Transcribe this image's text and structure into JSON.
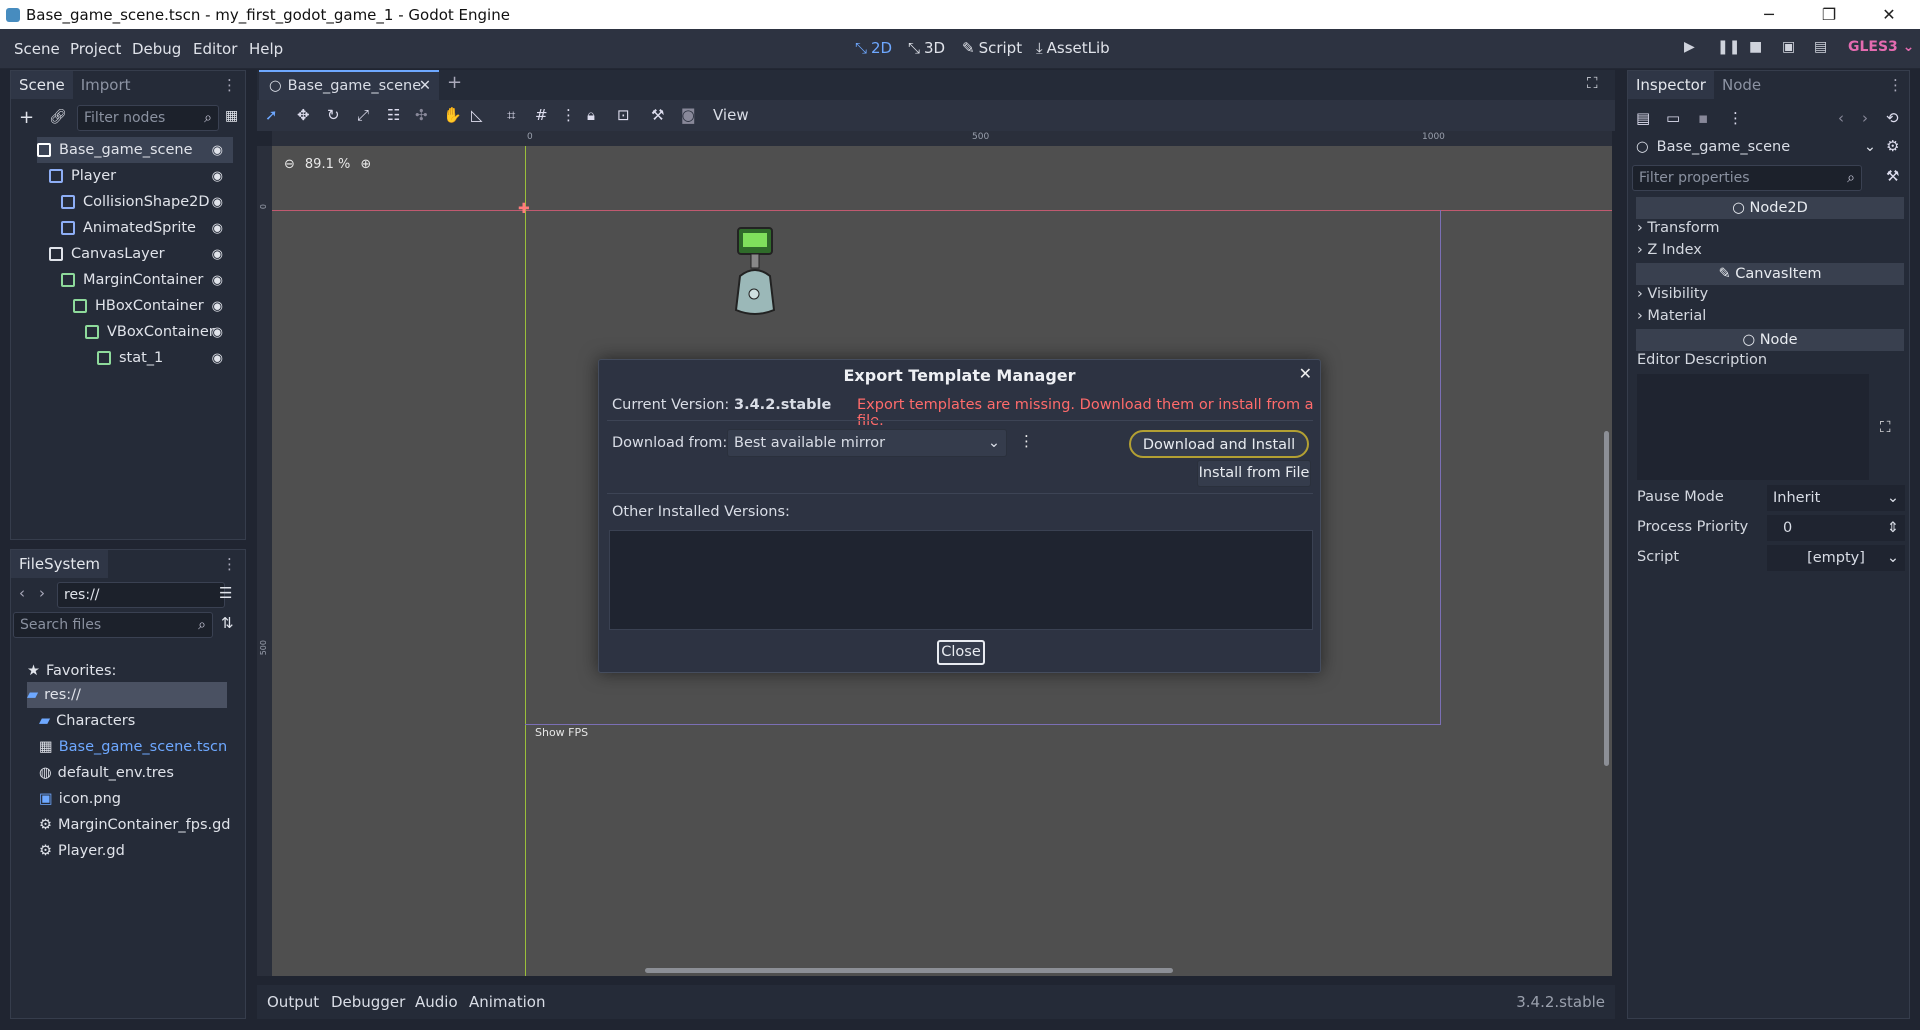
{
  "window": {
    "title": "Base_game_scene.tscn - my_first_godot_game_1 - Godot Engine",
    "min": "─",
    "max": "❐",
    "close": "✕"
  },
  "menu": {
    "items": [
      "Scene",
      "Project",
      "Debug",
      "Editor",
      "Help"
    ]
  },
  "workspaces": {
    "w2d": "2D",
    "w3d": "3D",
    "script": "Script",
    "assetlib": "AssetLib"
  },
  "renderer": "GLES3",
  "scene_dock": {
    "tabs": [
      "Scene",
      "Import"
    ],
    "filter_placeholder": "Filter nodes",
    "nodes": [
      {
        "label": "Base_game_scene",
        "depth": 0,
        "color": "#e0e3ea"
      },
      {
        "label": "Player",
        "depth": 1,
        "color": "#8eaef5"
      },
      {
        "label": "CollisionShape2D",
        "depth": 2,
        "color": "#8eaef5"
      },
      {
        "label": "AnimatedSprite",
        "depth": 2,
        "color": "#8eaef5"
      },
      {
        "label": "CanvasLayer",
        "depth": 1,
        "color": "#e0e3ea"
      },
      {
        "label": "MarginContainer",
        "depth": 2,
        "color": "#8eda9b"
      },
      {
        "label": "HBoxContainer",
        "depth": 3,
        "color": "#8eda9b"
      },
      {
        "label": "VBoxContainer",
        "depth": 4,
        "color": "#8eda9b"
      },
      {
        "label": "stat_1",
        "depth": 5,
        "color": "#8eda9b"
      }
    ]
  },
  "filesystem": {
    "tab": "FileSystem",
    "path": "res://",
    "search_placeholder": "Search files",
    "favorites": "Favorites:",
    "items": [
      {
        "label": "res://",
        "depth": 0
      },
      {
        "label": "Characters",
        "depth": 1
      },
      {
        "label": "Base_game_scene.tscn",
        "depth": 1
      },
      {
        "label": "default_env.tres",
        "depth": 1
      },
      {
        "label": "icon.png",
        "depth": 1
      },
      {
        "label": "MarginContainer_fps.gd",
        "depth": 1
      },
      {
        "label": "Player.gd",
        "depth": 1
      }
    ]
  },
  "editor": {
    "scene_tab": "Base_game_scene",
    "zoom": "89.1 %",
    "view_menu": "View",
    "ruler": [
      "0",
      "500",
      "1000"
    ],
    "ruler_v": [
      "0",
      "500"
    ],
    "show_fps": "Show FPS"
  },
  "dialog": {
    "title": "Export Template Manager",
    "current_version_label": "Current Version:",
    "current_version": "3.4.2.stable",
    "error": "Export templates are missing. Download them or install from a file.",
    "download_from_label": "Download from:",
    "mirror": "Best available mirror",
    "download_install": "Download and Install",
    "install_file": "Install from File",
    "other_versions": "Other Installed Versions:",
    "close": "Close"
  },
  "bottom": {
    "tabs": [
      "Output",
      "Debugger",
      "Audio",
      "Animation"
    ],
    "version": "3.4.2.stable"
  },
  "inspector": {
    "tabs": [
      "Inspector",
      "Node"
    ],
    "object": "Base_game_scene",
    "filter_placeholder": "Filter properties",
    "sections": {
      "node2d": "Node2D",
      "canvasitem": "CanvasItem",
      "node": "Node"
    },
    "groups": {
      "transform": "Transform",
      "zindex": "Z Index",
      "visibility": "Visibility",
      "material": "Material"
    },
    "editor_description": "Editor Description",
    "pause_mode": {
      "label": "Pause Mode",
      "value": "Inherit"
    },
    "process_priority": {
      "label": "Process Priority",
      "value": "0"
    },
    "script": {
      "label": "Script",
      "value": "[empty]"
    }
  }
}
